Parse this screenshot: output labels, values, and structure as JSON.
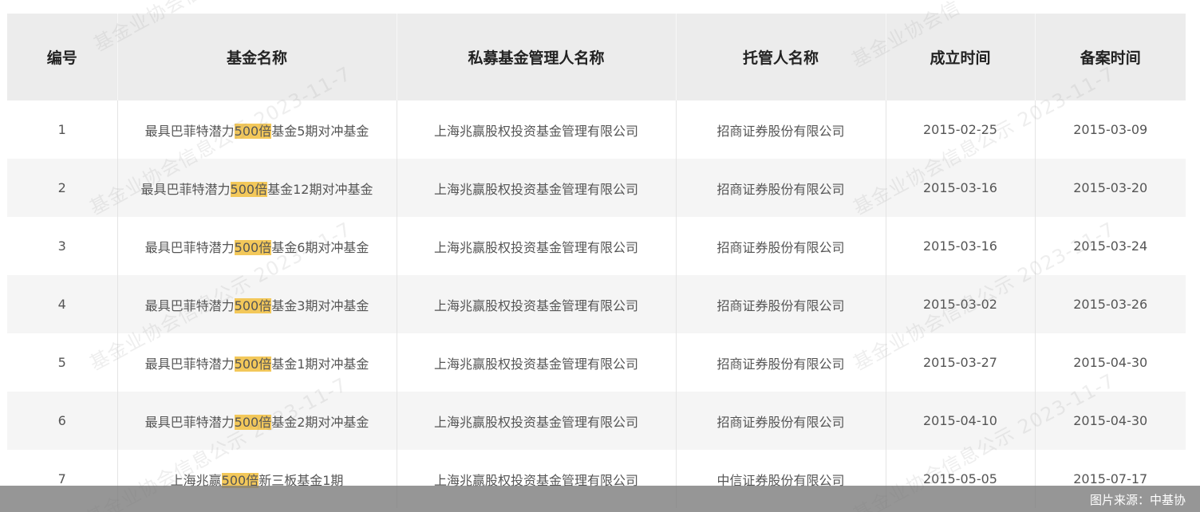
{
  "table": {
    "headers": [
      "编号",
      "基金名称",
      "私募基金管理人名称",
      "托管人名称",
      "成立时间",
      "备案时间"
    ],
    "rows": [
      {
        "no": "1",
        "name_pre": "最具巴菲特潜力",
        "name_hl": "500倍",
        "name_post": "基金5期对冲基金",
        "manager": "上海兆赢股权投资基金管理有限公司",
        "custodian": "招商证券股份有限公司",
        "established": "2015-02-25",
        "filed": "2015-03-09"
      },
      {
        "no": "2",
        "name_pre": "最具巴菲特潜力",
        "name_hl": "500倍",
        "name_post": "基金12期对冲基金",
        "manager": "上海兆赢股权投资基金管理有限公司",
        "custodian": "招商证券股份有限公司",
        "established": "2015-03-16",
        "filed": "2015-03-20"
      },
      {
        "no": "3",
        "name_pre": "最具巴菲特潜力",
        "name_hl": "500倍",
        "name_post": "基金6期对冲基金",
        "manager": "上海兆赢股权投资基金管理有限公司",
        "custodian": "招商证券股份有限公司",
        "established": "2015-03-16",
        "filed": "2015-03-24"
      },
      {
        "no": "4",
        "name_pre": "最具巴菲特潜力",
        "name_hl": "500倍",
        "name_post": "基金3期对冲基金",
        "manager": "上海兆赢股权投资基金管理有限公司",
        "custodian": "招商证券股份有限公司",
        "established": "2015-03-02",
        "filed": "2015-03-26"
      },
      {
        "no": "5",
        "name_pre": "最具巴菲特潜力",
        "name_hl": "500倍",
        "name_post": "基金1期对冲基金",
        "manager": "上海兆赢股权投资基金管理有限公司",
        "custodian": "招商证券股份有限公司",
        "established": "2015-03-27",
        "filed": "2015-04-30"
      },
      {
        "no": "6",
        "name_pre": "最具巴菲特潜力",
        "name_hl": "500倍",
        "name_post": "基金2期对冲基金",
        "manager": "上海兆赢股权投资基金管理有限公司",
        "custodian": "招商证券股份有限公司",
        "established": "2015-04-10",
        "filed": "2015-04-30"
      },
      {
        "no": "7",
        "name_pre": "上海兆赢",
        "name_hl": "500倍",
        "name_post": "新三板基金1期",
        "manager": "上海兆赢股权投资基金管理有限公司",
        "custodian": "中信证券股份有限公司",
        "established": "2015-05-05",
        "filed": "2015-07-17"
      }
    ]
  },
  "watermark": {
    "text_long": "基金业协会信息公示 2023-11-7",
    "text_short": "基金业协会信"
  },
  "caption": "图片来源：中基协",
  "colors": {
    "header_bg": "#ececec",
    "row_alt_bg": "#f5f5f5",
    "highlight": "#f3c85a",
    "caption_bg": "#787878"
  }
}
